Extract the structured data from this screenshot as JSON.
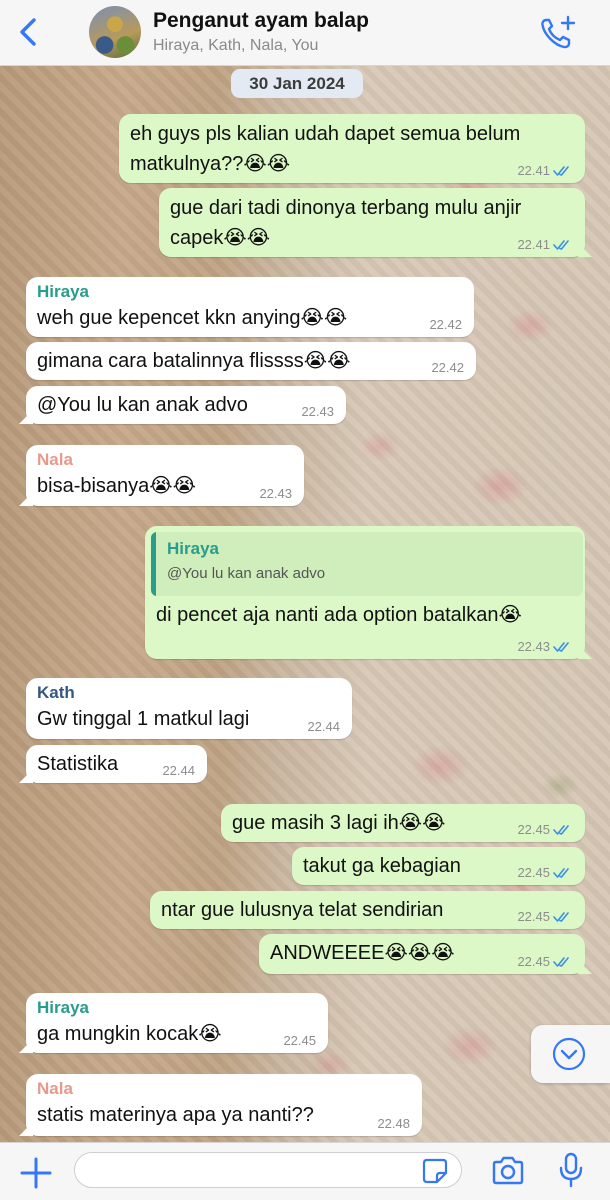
{
  "header": {
    "title": "Penganut ayam balap",
    "subtitle": "Hiraya, Kath, Nala, You"
  },
  "date_chip": "30 Jan 2024",
  "colors": {
    "accent": "#3478f6",
    "outgoing_bubble": "#dbf8c6",
    "incoming_bubble": "#ffffff",
    "sender_hiraya": "#2a9c8c",
    "sender_kath": "#35577f",
    "sender_nala": "#e69a8c"
  },
  "messages": [
    {
      "dir": "out",
      "lines": [
        "eh guys pls kalian udah dapet semua belum",
        "matkulnya??😭😭"
      ],
      "time": "22.41",
      "read": true
    },
    {
      "dir": "out",
      "lines": [
        "gue dari tadi dinonya terbang mulu anjir",
        "capek😭😭"
      ],
      "time": "22.41",
      "read": true
    },
    {
      "dir": "in",
      "sender": "Hiraya",
      "text": "weh gue kepencet kkn anying😭😭",
      "time": "22.42"
    },
    {
      "dir": "in",
      "text": "gimana cara batalinnya flissss😭😭",
      "time": "22.42"
    },
    {
      "dir": "in",
      "text": "@You lu kan anak advo",
      "time": "22.43"
    },
    {
      "dir": "in",
      "sender": "Nala",
      "text": "bisa-bisanya😭😭",
      "time": "22.43"
    },
    {
      "dir": "out",
      "quote": {
        "sender": "Hiraya",
        "text": "@You lu kan anak advo"
      },
      "text": "di pencet aja nanti ada option batalkan😭",
      "time": "22.43",
      "read": true
    },
    {
      "dir": "in",
      "sender": "Kath",
      "text": "Gw tinggal 1 matkul lagi",
      "time": "22.44"
    },
    {
      "dir": "in",
      "text": "Statistika",
      "time": "22.44"
    },
    {
      "dir": "out",
      "text": "gue masih 3 lagi ih😭😭",
      "time": "22.45",
      "read": true
    },
    {
      "dir": "out",
      "text": "takut ga kebagian",
      "time": "22.45",
      "read": true
    },
    {
      "dir": "out",
      "text": "ntar gue lulusnya telat sendirian",
      "time": "22.45",
      "read": true
    },
    {
      "dir": "out",
      "text": "ANDWEEEE😭😭😭",
      "time": "22.45",
      "read": true
    },
    {
      "dir": "in",
      "sender": "Hiraya",
      "text": "ga mungkin kocak😭",
      "time": "22.45"
    },
    {
      "dir": "in",
      "sender": "Nala",
      "text": "statis materinya apa ya nanti??",
      "time": "22.48"
    }
  ],
  "composer": {
    "value": "",
    "placeholder": ""
  },
  "icons": {
    "back": "chevron-left-icon",
    "call": "phone-plus-icon",
    "scroll": "chevron-down-circle-icon",
    "plus": "plus-icon",
    "sticker": "sticker-icon",
    "camera": "camera-icon",
    "mic": "microphone-icon",
    "read": "double-check-icon"
  }
}
